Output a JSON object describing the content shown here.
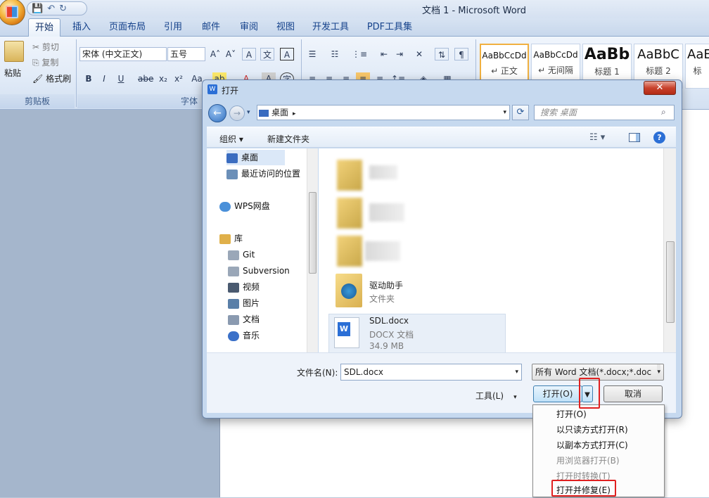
{
  "window": {
    "title": "文档 1 - Microsoft Word"
  },
  "qat": {
    "save": "💾",
    "undo": "↶",
    "redo": "↻"
  },
  "tabs": [
    "开始",
    "插入",
    "页面布局",
    "引用",
    "邮件",
    "审阅",
    "视图",
    "开发工具",
    "PDF工具集"
  ],
  "ribbon": {
    "clipboard": {
      "paste": "粘贴",
      "cut": "剪切",
      "copy": "复制",
      "format_painter": "格式刷",
      "label": "剪贴板"
    },
    "font": {
      "font_name": "宋体 (中文正文)",
      "font_size": "五号",
      "label": "字体"
    },
    "styles": [
      {
        "sample": "AaBbCcDd",
        "name": "↵ 正文"
      },
      {
        "sample": "AaBbCcDd",
        "name": "↵ 无间隔"
      },
      {
        "sample": "AaBb",
        "name": "标题 1"
      },
      {
        "sample": "AaBbC",
        "name": "标题 2"
      },
      {
        "sample": "AaE",
        "name": "标"
      }
    ]
  },
  "dialog": {
    "title": "打开",
    "close": "✕",
    "address": "桌面",
    "search_placeholder": "搜索 桌面",
    "toolbar": {
      "organize": "组织 ▾",
      "new_folder": "新建文件夹"
    },
    "nav": [
      {
        "label": "桌面",
        "color": "#3a6cc0"
      },
      {
        "label": "最近访问的位置",
        "color": "#6b8fb8"
      },
      {
        "label": "WPS网盘",
        "color": "#4a90d9"
      },
      {
        "label": "库",
        "color": "#e0b04a"
      },
      {
        "label": "Git",
        "color": "#9aa7b8"
      },
      {
        "label": "Subversion",
        "color": "#9aa7b8"
      },
      {
        "label": "视频",
        "color": "#4a5a70"
      },
      {
        "label": "图片",
        "color": "#5a7fa8"
      },
      {
        "label": "文档",
        "color": "#8a9ab0"
      },
      {
        "label": "音乐",
        "color": "#3a70c8"
      }
    ],
    "files": [
      {
        "name": "驱动助手",
        "type": "文件夹"
      },
      {
        "name": "SDL.docx",
        "type": "DOCX 文档",
        "size": "34.9 MB"
      }
    ],
    "filename_label": "文件名(N):",
    "filename_value": "SDL.docx",
    "filetype_value": "所有 Word 文档(*.docx;*.doc",
    "tools": "工具(L)",
    "open_button": "打开(O)",
    "cancel_button": "取消"
  },
  "open_menu": [
    {
      "label": "打开(O)",
      "disabled": false
    },
    {
      "label": "以只读方式打开(R)",
      "disabled": false
    },
    {
      "label": "以副本方式打开(C)",
      "disabled": false
    },
    {
      "label": "用浏览器打开(B)",
      "disabled": true
    },
    {
      "label": "打开时转换(T)",
      "disabled": true
    },
    {
      "label": "打开并修复(E)",
      "disabled": false
    }
  ],
  "colors": {
    "highlight": "#e02020",
    "folder": "#f2c94c",
    "word_blue": "#2b6fd6"
  }
}
